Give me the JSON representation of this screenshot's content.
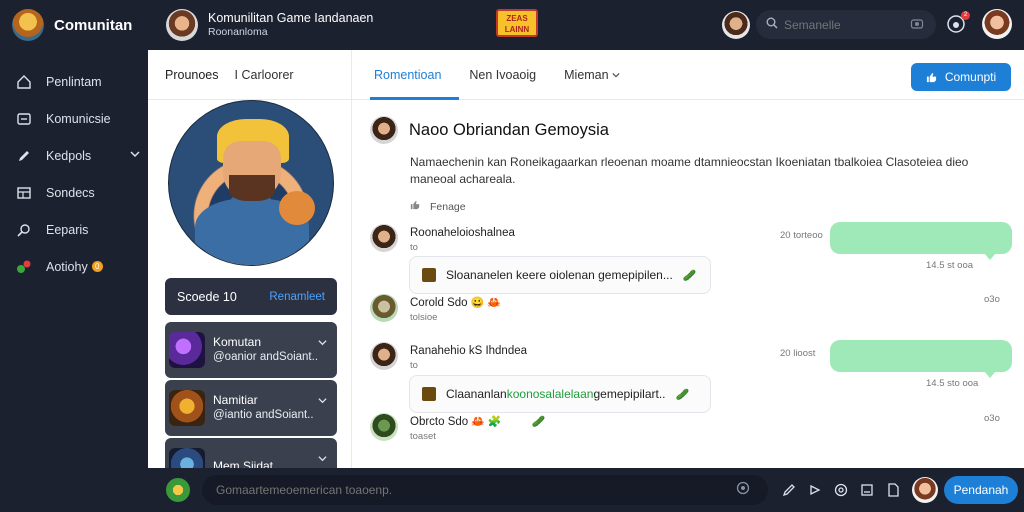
{
  "app": {
    "title": "Comunitan"
  },
  "sidebar": {
    "items": [
      {
        "label": "Penlintam",
        "icon": "home-icon"
      },
      {
        "label": "Komunicsie",
        "icon": "inbox-icon"
      },
      {
        "label": "Kedpols",
        "icon": "pen-icon"
      },
      {
        "label": "Sondecs",
        "icon": "grid-icon"
      },
      {
        "label": "Eeparis",
        "icon": "search-icon"
      },
      {
        "label": "Aotiohy",
        "icon": "activity-icon",
        "badge": "0"
      }
    ]
  },
  "topbar": {
    "title": "Komunilitan Game Iandanaen",
    "subtitle": "Roonanloma",
    "logo_text": "ZEAS LAINN",
    "search_placeholder": "Semanelle",
    "notification_count": "2"
  },
  "left_panel": {
    "tabs": [
      "Prounoes",
      "I Carloorer"
    ],
    "score_label": "Scoede 10",
    "score_link": "Renamleet",
    "games": [
      {
        "title": "Komutan",
        "subtitle": "@oanior andSoiant.."
      },
      {
        "title": "Namitiar",
        "subtitle": "@iantio andSoiant.."
      },
      {
        "title": "Mem Siidat",
        "subtitle": ""
      }
    ]
  },
  "main": {
    "tabs": [
      "Romentioan",
      "Nen Ivoaoig",
      "Mieman"
    ],
    "community_button": "Comunpti",
    "post": {
      "title": "Naoo Obriandan Gemoysia",
      "body": "Namaechenin kan Roneikagaarkan rleoenan moame dtamnieocstan Ikoeniatan tbalkoiea Clasoteiea dieo maneoal achareala.",
      "meta": "Fenage"
    },
    "comments": [
      {
        "name": "Roonaheloioshalnea",
        "small": "to",
        "message": "Sloananelen keere oiolenan gemepipilen...",
        "bubble_time": "14.5 st ooa",
        "side_time": "20 torteoo"
      },
      {
        "name": "Corold Sdo",
        "small": "tolsioe",
        "side_time": "o3o"
      },
      {
        "name": "Ranahehio kS Ihdndea",
        "small": "to",
        "message_plain": "Claananlan ",
        "message_green": "koonosalalelaan",
        "message_rest": " gemepipilart..",
        "bubble_time": "14.5 sto ooa",
        "side_time": "20 lioost"
      },
      {
        "name": "Obrcto Sdo",
        "small": "toaset",
        "side_time": "o3o"
      }
    ]
  },
  "bottombar": {
    "placeholder": "Gomaartemeoemerican toaoenp.",
    "send_button": "Pendanah"
  },
  "colors": {
    "accent": "#1e7fd6",
    "bubble": "#9fe8b8",
    "dark": "#1c2130"
  }
}
